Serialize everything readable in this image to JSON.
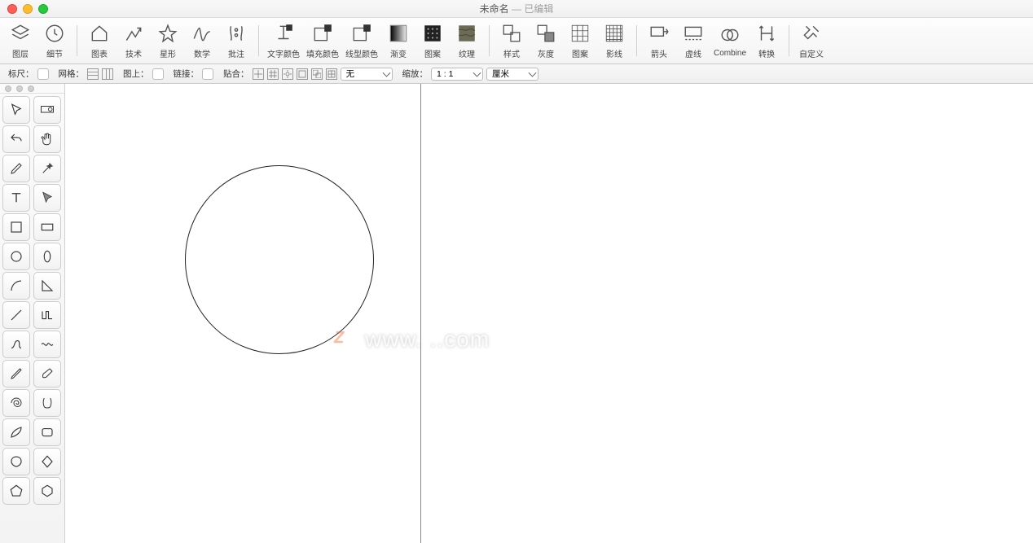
{
  "title": {
    "name": "未命名",
    "sep": " — ",
    "state": "已编辑"
  },
  "toolbar": {
    "layers": "图层",
    "details": "细节",
    "chart": "图表",
    "tech": "技术",
    "star": "星形",
    "math": "数学",
    "annot": "批注",
    "textcolor": "文字颜色",
    "fillcolor": "填充颜色",
    "linecolor": "线型颜色",
    "gradient": "渐变",
    "pattern": "图案",
    "texture": "纹理",
    "style": "样式",
    "gray": "灰度",
    "pattern2": "图案",
    "hatch": "影线",
    "arrow": "箭头",
    "dash": "虚线",
    "combine": "Combine",
    "transform": "转换",
    "custom": "自定义"
  },
  "optbar": {
    "ruler": "标尺：",
    "grid": "网格：",
    "onpage": "图上：",
    "link": "链接：",
    "snap": "贴合：",
    "snap_sel": "无",
    "zoom": "缩放：",
    "zoom_sel": "1 : 1",
    "unit_sel": "厘米"
  },
  "watermark": "www. ..com"
}
